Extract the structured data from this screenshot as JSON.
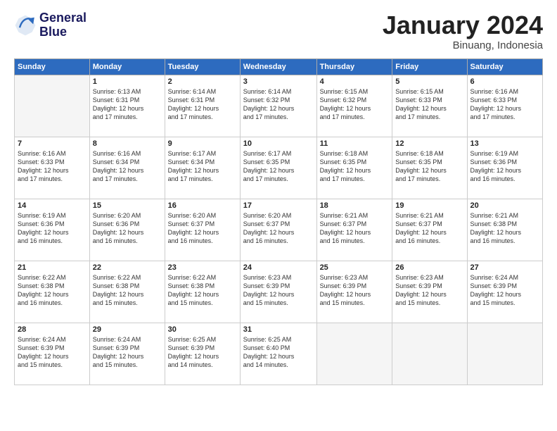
{
  "header": {
    "logo_line1": "General",
    "logo_line2": "Blue",
    "month": "January 2024",
    "location": "Binuang, Indonesia"
  },
  "days_of_week": [
    "Sunday",
    "Monday",
    "Tuesday",
    "Wednesday",
    "Thursday",
    "Friday",
    "Saturday"
  ],
  "weeks": [
    [
      {
        "day": "",
        "info": ""
      },
      {
        "day": "1",
        "info": "Sunrise: 6:13 AM\nSunset: 6:31 PM\nDaylight: 12 hours\nand 17 minutes."
      },
      {
        "day": "2",
        "info": "Sunrise: 6:14 AM\nSunset: 6:31 PM\nDaylight: 12 hours\nand 17 minutes."
      },
      {
        "day": "3",
        "info": "Sunrise: 6:14 AM\nSunset: 6:32 PM\nDaylight: 12 hours\nand 17 minutes."
      },
      {
        "day": "4",
        "info": "Sunrise: 6:15 AM\nSunset: 6:32 PM\nDaylight: 12 hours\nand 17 minutes."
      },
      {
        "day": "5",
        "info": "Sunrise: 6:15 AM\nSunset: 6:33 PM\nDaylight: 12 hours\nand 17 minutes."
      },
      {
        "day": "6",
        "info": "Sunrise: 6:16 AM\nSunset: 6:33 PM\nDaylight: 12 hours\nand 17 minutes."
      }
    ],
    [
      {
        "day": "7",
        "info": "Sunrise: 6:16 AM\nSunset: 6:33 PM\nDaylight: 12 hours\nand 17 minutes."
      },
      {
        "day": "8",
        "info": "Sunrise: 6:16 AM\nSunset: 6:34 PM\nDaylight: 12 hours\nand 17 minutes."
      },
      {
        "day": "9",
        "info": "Sunrise: 6:17 AM\nSunset: 6:34 PM\nDaylight: 12 hours\nand 17 minutes."
      },
      {
        "day": "10",
        "info": "Sunrise: 6:17 AM\nSunset: 6:35 PM\nDaylight: 12 hours\nand 17 minutes."
      },
      {
        "day": "11",
        "info": "Sunrise: 6:18 AM\nSunset: 6:35 PM\nDaylight: 12 hours\nand 17 minutes."
      },
      {
        "day": "12",
        "info": "Sunrise: 6:18 AM\nSunset: 6:35 PM\nDaylight: 12 hours\nand 17 minutes."
      },
      {
        "day": "13",
        "info": "Sunrise: 6:19 AM\nSunset: 6:36 PM\nDaylight: 12 hours\nand 16 minutes."
      }
    ],
    [
      {
        "day": "14",
        "info": "Sunrise: 6:19 AM\nSunset: 6:36 PM\nDaylight: 12 hours\nand 16 minutes."
      },
      {
        "day": "15",
        "info": "Sunrise: 6:20 AM\nSunset: 6:36 PM\nDaylight: 12 hours\nand 16 minutes."
      },
      {
        "day": "16",
        "info": "Sunrise: 6:20 AM\nSunset: 6:37 PM\nDaylight: 12 hours\nand 16 minutes."
      },
      {
        "day": "17",
        "info": "Sunrise: 6:20 AM\nSunset: 6:37 PM\nDaylight: 12 hours\nand 16 minutes."
      },
      {
        "day": "18",
        "info": "Sunrise: 6:21 AM\nSunset: 6:37 PM\nDaylight: 12 hours\nand 16 minutes."
      },
      {
        "day": "19",
        "info": "Sunrise: 6:21 AM\nSunset: 6:37 PM\nDaylight: 12 hours\nand 16 minutes."
      },
      {
        "day": "20",
        "info": "Sunrise: 6:21 AM\nSunset: 6:38 PM\nDaylight: 12 hours\nand 16 minutes."
      }
    ],
    [
      {
        "day": "21",
        "info": "Sunrise: 6:22 AM\nSunset: 6:38 PM\nDaylight: 12 hours\nand 16 minutes."
      },
      {
        "day": "22",
        "info": "Sunrise: 6:22 AM\nSunset: 6:38 PM\nDaylight: 12 hours\nand 15 minutes."
      },
      {
        "day": "23",
        "info": "Sunrise: 6:22 AM\nSunset: 6:38 PM\nDaylight: 12 hours\nand 15 minutes."
      },
      {
        "day": "24",
        "info": "Sunrise: 6:23 AM\nSunset: 6:39 PM\nDaylight: 12 hours\nand 15 minutes."
      },
      {
        "day": "25",
        "info": "Sunrise: 6:23 AM\nSunset: 6:39 PM\nDaylight: 12 hours\nand 15 minutes."
      },
      {
        "day": "26",
        "info": "Sunrise: 6:23 AM\nSunset: 6:39 PM\nDaylight: 12 hours\nand 15 minutes."
      },
      {
        "day": "27",
        "info": "Sunrise: 6:24 AM\nSunset: 6:39 PM\nDaylight: 12 hours\nand 15 minutes."
      }
    ],
    [
      {
        "day": "28",
        "info": "Sunrise: 6:24 AM\nSunset: 6:39 PM\nDaylight: 12 hours\nand 15 minutes."
      },
      {
        "day": "29",
        "info": "Sunrise: 6:24 AM\nSunset: 6:39 PM\nDaylight: 12 hours\nand 15 minutes."
      },
      {
        "day": "30",
        "info": "Sunrise: 6:25 AM\nSunset: 6:39 PM\nDaylight: 12 hours\nand 14 minutes."
      },
      {
        "day": "31",
        "info": "Sunrise: 6:25 AM\nSunset: 6:40 PM\nDaylight: 12 hours\nand 14 minutes."
      },
      {
        "day": "",
        "info": ""
      },
      {
        "day": "",
        "info": ""
      },
      {
        "day": "",
        "info": ""
      }
    ]
  ]
}
